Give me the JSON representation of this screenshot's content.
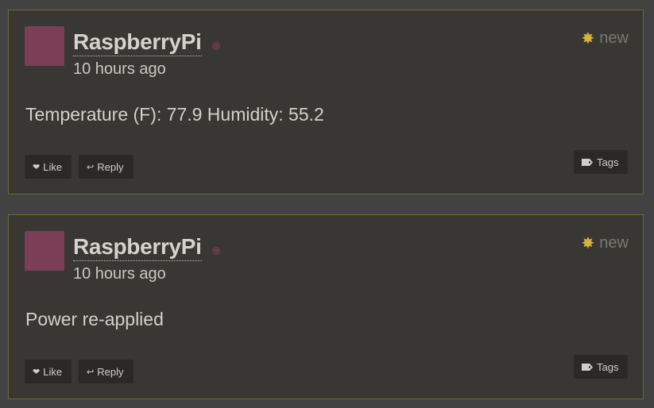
{
  "posts": [
    {
      "username": "RaspberryPi",
      "timestamp": "10 hours ago",
      "badge": "new",
      "message": "Temperature (F): 77.9 Humidity: 55.2",
      "like_label": "Like",
      "reply_label": "Reply",
      "tags_label": "Tags"
    },
    {
      "username": "RaspberryPi",
      "timestamp": "10 hours ago",
      "badge": "new",
      "message": "Power re-applied",
      "like_label": "Like",
      "reply_label": "Reply",
      "tags_label": "Tags"
    }
  ],
  "icons": {
    "avatar_color": "#7a3e56",
    "new_icon": "starburst-icon",
    "like_icon": "heart-icon",
    "reply_icon": "reply-arrow-icon",
    "tags_icon": "tag-icon"
  }
}
